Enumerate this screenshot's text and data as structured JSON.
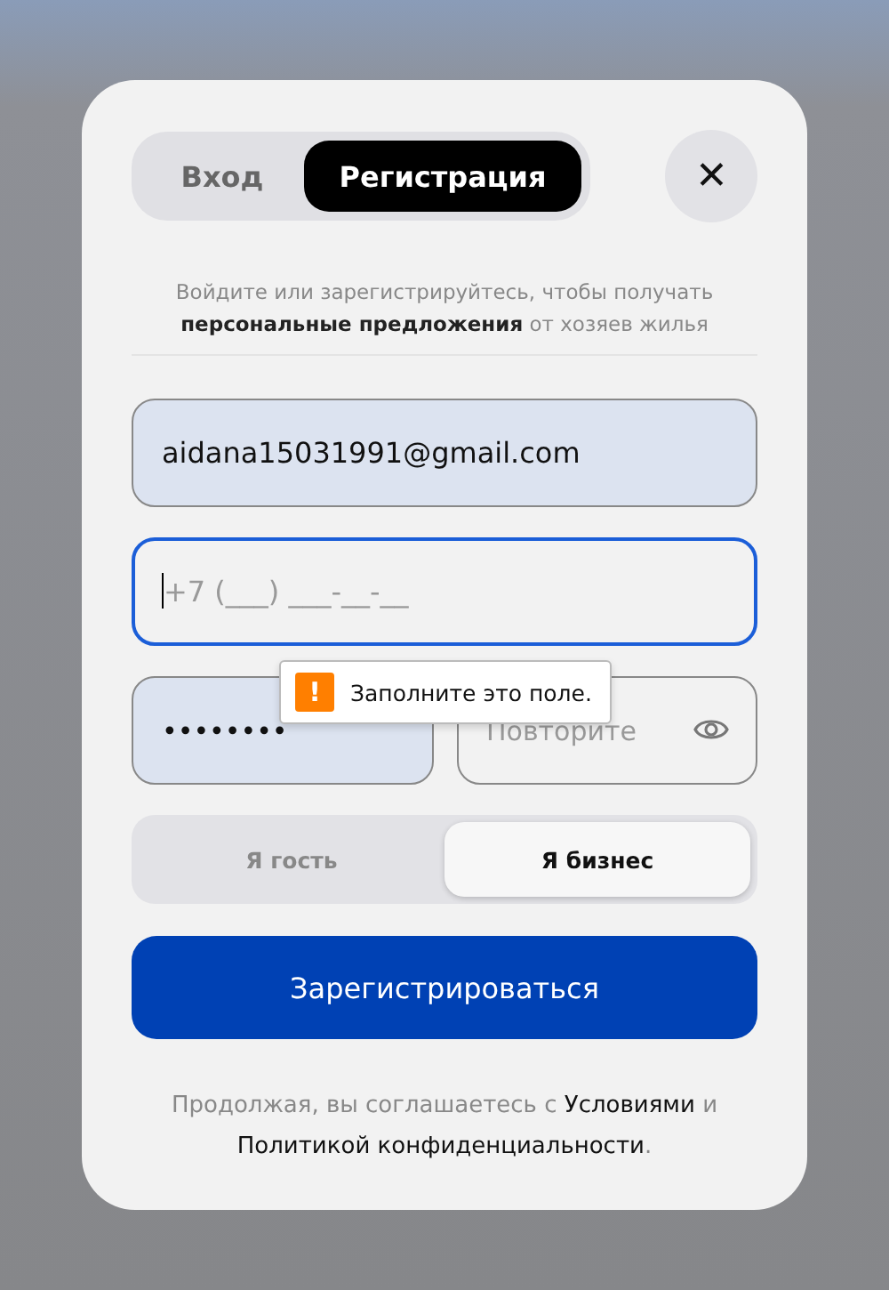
{
  "tabs": [
    {
      "label": "Вход",
      "selected": false
    },
    {
      "label": "Регистрация",
      "selected": true
    }
  ],
  "close": {
    "label": "✕"
  },
  "subtitle": "Войдите или зарегистрируйтесь, чтобы получать **персональные предложения** от хозяев жилья",
  "fields": [
    {
      "value": "aidana15031991@gmail.com",
      "filled": true,
      "focused": false
    },
    {
      "placeholder": "+7 (___) ___-__-__",
      "filled": false,
      "focused": true
    }
  ],
  "password_fields": [
    {
      "value": "••••••••",
      "filled": true
    },
    {
      "placeholder": "Повторите",
      "filled": false
    }
  ],
  "tooltip": {
    "icon": "!",
    "text": "Заполните это поле."
  },
  "roles": [
    {
      "label": "Я гость",
      "selected": false
    },
    {
      "label": "Я бизнес",
      "selected": true
    }
  ],
  "submit": "Зарегистрироваться",
  "footer": {
    "text": "Продолжая, вы соглашаетесь с",
    "link1": "Условиями",
    "and": "и",
    "link2": "Политикой конфиденциальности",
    "end": "."
  }
}
